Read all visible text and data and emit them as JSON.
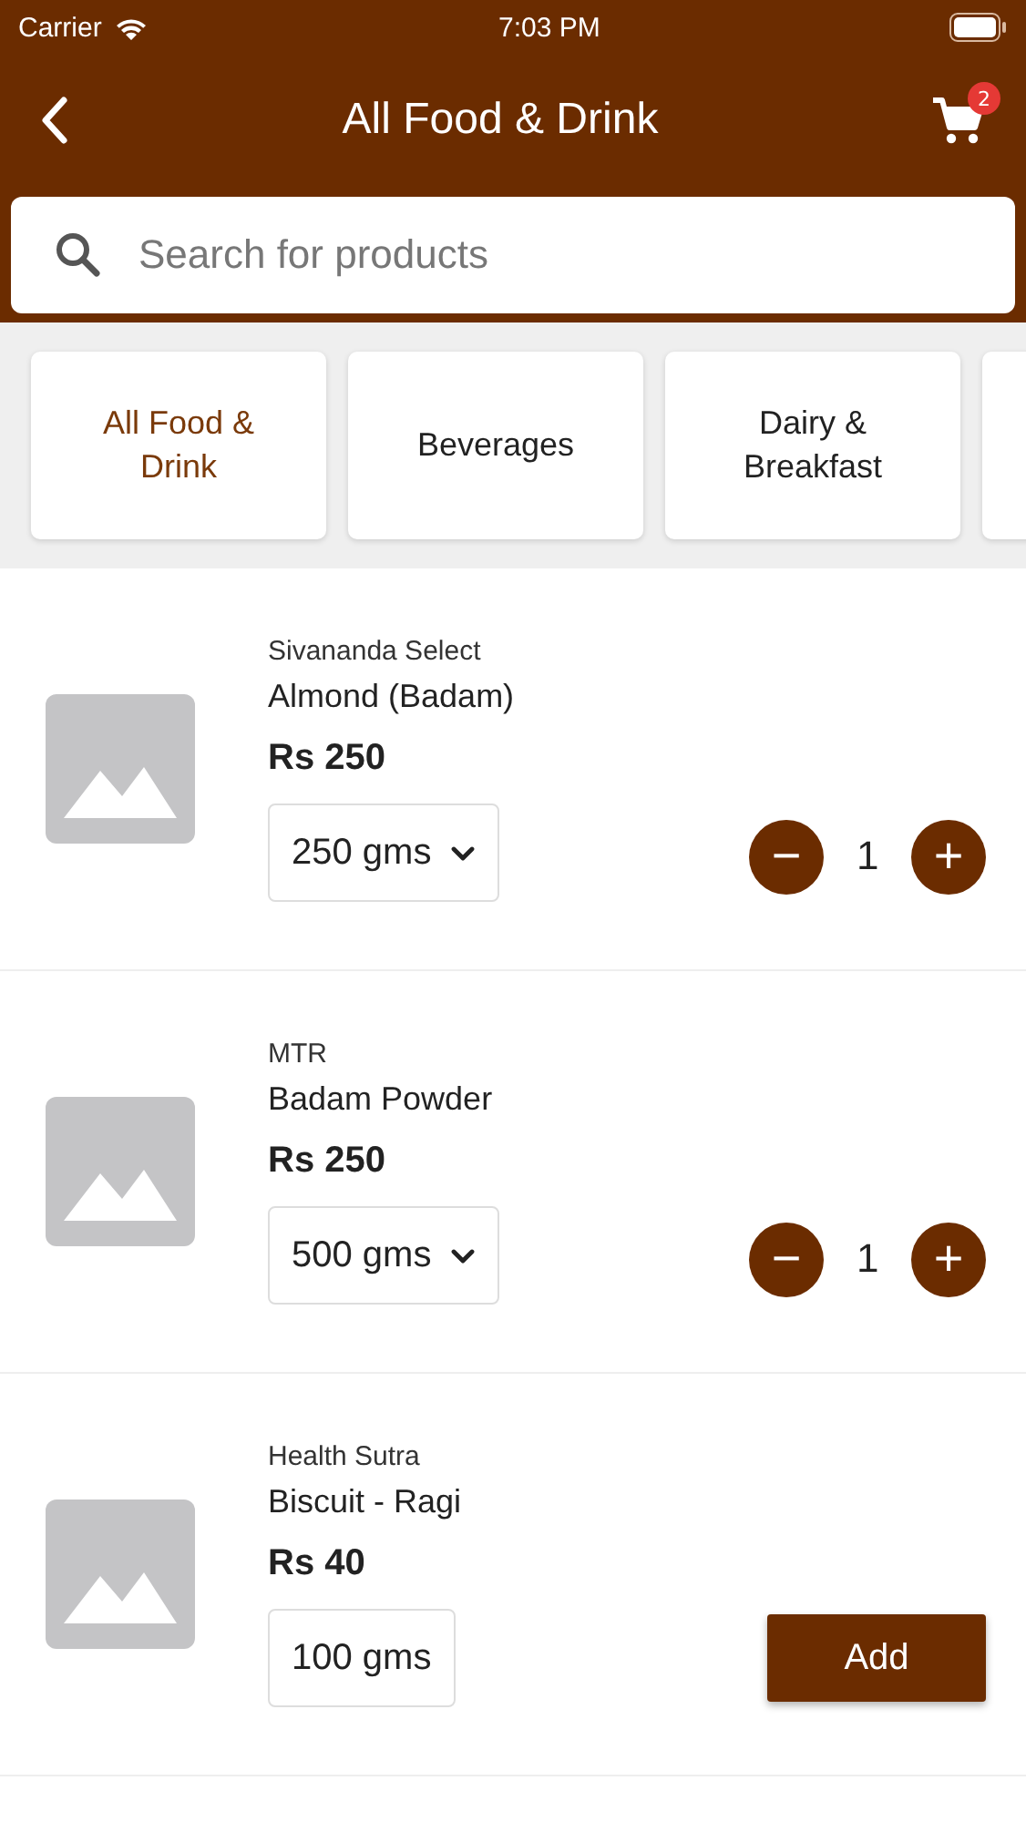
{
  "status_bar": {
    "carrier": "Carrier",
    "time": "7:03 PM"
  },
  "nav": {
    "title": "All Food & Drink",
    "cart_count": "2"
  },
  "search": {
    "placeholder": "Search for products"
  },
  "categories": [
    {
      "label": "All Food & Drink",
      "selected": true
    },
    {
      "label": "Beverages",
      "selected": false
    },
    {
      "label": "Dairy & Breakfast",
      "selected": false
    }
  ],
  "products": [
    {
      "brand": "Sivananda Select",
      "name": "Almond (Badam)",
      "price": "Rs 250",
      "size": "250 gms",
      "has_options": true,
      "kind": "stepper",
      "quantity": "1",
      "minus": "−",
      "plus": "+"
    },
    {
      "brand": "MTR",
      "name": "Badam Powder",
      "price": "Rs 250",
      "size": "500 gms",
      "has_options": true,
      "kind": "stepper",
      "quantity": "1",
      "minus": "−",
      "plus": "+"
    },
    {
      "brand": "Health Sutra",
      "name": "Biscuit - Ragi",
      "price": "Rs 40",
      "size": "100 gms",
      "has_options": false,
      "kind": "add",
      "button": "Add"
    }
  ]
}
